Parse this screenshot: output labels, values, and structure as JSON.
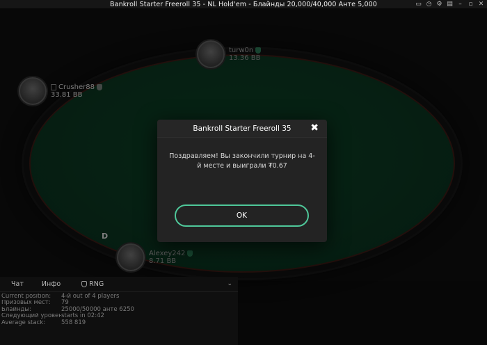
{
  "window": {
    "title": "Bankroll Starter Freeroll 35 - NL Hold'em - Блайнды 20,000/40,000 Анте 5,000",
    "controls": [
      "history-icon",
      "clock-icon",
      "gear-icon",
      "cards-icon",
      "minimize-icon",
      "maximize-icon",
      "close-icon"
    ]
  },
  "players": [
    {
      "name": "turw0n",
      "stack": "13.36 BB"
    },
    {
      "name": "Crusher88",
      "stack": "33.81 BB"
    },
    {
      "name": "Alexey242",
      "stack": "8.71 BB"
    }
  ],
  "dealer_button": "D",
  "modal": {
    "title": "Bankroll Starter Freeroll 35",
    "message": "Поздравляем! Вы закончили турнир на 4-й месте и выиграли ₮0.67",
    "ok_label": "OK"
  },
  "info_panel": {
    "tabs": [
      "Чат",
      "Инфо",
      "RNG"
    ],
    "stats": [
      {
        "label": "Current position:",
        "value": "4-й out of 4 players"
      },
      {
        "label": "Призовых мест:",
        "value": "79"
      },
      {
        "label": "Блайнды:",
        "value": "25000/50000 анте 6250"
      },
      {
        "label": "Следующий уровень:",
        "value": "starts in 02:42"
      },
      {
        "label": "Average stack:",
        "value": "558 819"
      }
    ]
  },
  "colors": {
    "felt": "#0a3520",
    "accent": "#4fc89a",
    "modal_bg": "#232323"
  }
}
